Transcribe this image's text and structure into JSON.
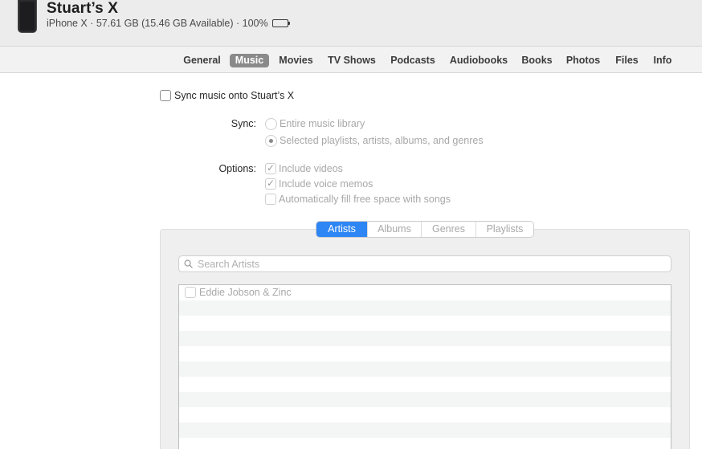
{
  "device": {
    "name": "Stuart’s X",
    "info": "iPhone X · 57.61 GB (15.46 GB Available) · 100%",
    "icon": "iphone-icon",
    "battery_icon": "battery-full-icon"
  },
  "tabs": [
    {
      "label": "General",
      "active": false
    },
    {
      "label": "Music",
      "active": true
    },
    {
      "label": "Movies",
      "active": false
    },
    {
      "label": "TV Shows",
      "active": false
    },
    {
      "label": "Podcasts",
      "active": false
    },
    {
      "label": "Audiobooks",
      "active": false
    },
    {
      "label": "Books",
      "active": false
    },
    {
      "label": "Photos",
      "active": false
    },
    {
      "label": "Files",
      "active": false
    },
    {
      "label": "Info",
      "active": false
    }
  ],
  "sync_music": {
    "label": "Sync music onto Stuart’s X",
    "checked": false
  },
  "sync": {
    "label": "Sync:",
    "options": [
      {
        "label": "Entire music library",
        "selected": false
      },
      {
        "label": "Selected playlists, artists, albums, and genres",
        "selected": true
      }
    ]
  },
  "options": {
    "label": "Options:",
    "items": [
      {
        "label": "Include videos",
        "checked": true
      },
      {
        "label": "Include voice memos",
        "checked": true
      },
      {
        "label": "Automatically fill free space with songs",
        "checked": false
      }
    ]
  },
  "browser": {
    "segments": [
      {
        "label": "Artists",
        "active": true
      },
      {
        "label": "Albums",
        "active": false
      },
      {
        "label": "Genres",
        "active": false
      },
      {
        "label": "Playlists",
        "active": false
      }
    ],
    "search_placeholder": "Search Artists",
    "search_value": "",
    "rows": [
      {
        "label": "Eddie Jobson & Zinc",
        "checked": false
      }
    ]
  },
  "colors": {
    "accent": "#2e86f5",
    "active_tab": "#8a8a8a"
  }
}
